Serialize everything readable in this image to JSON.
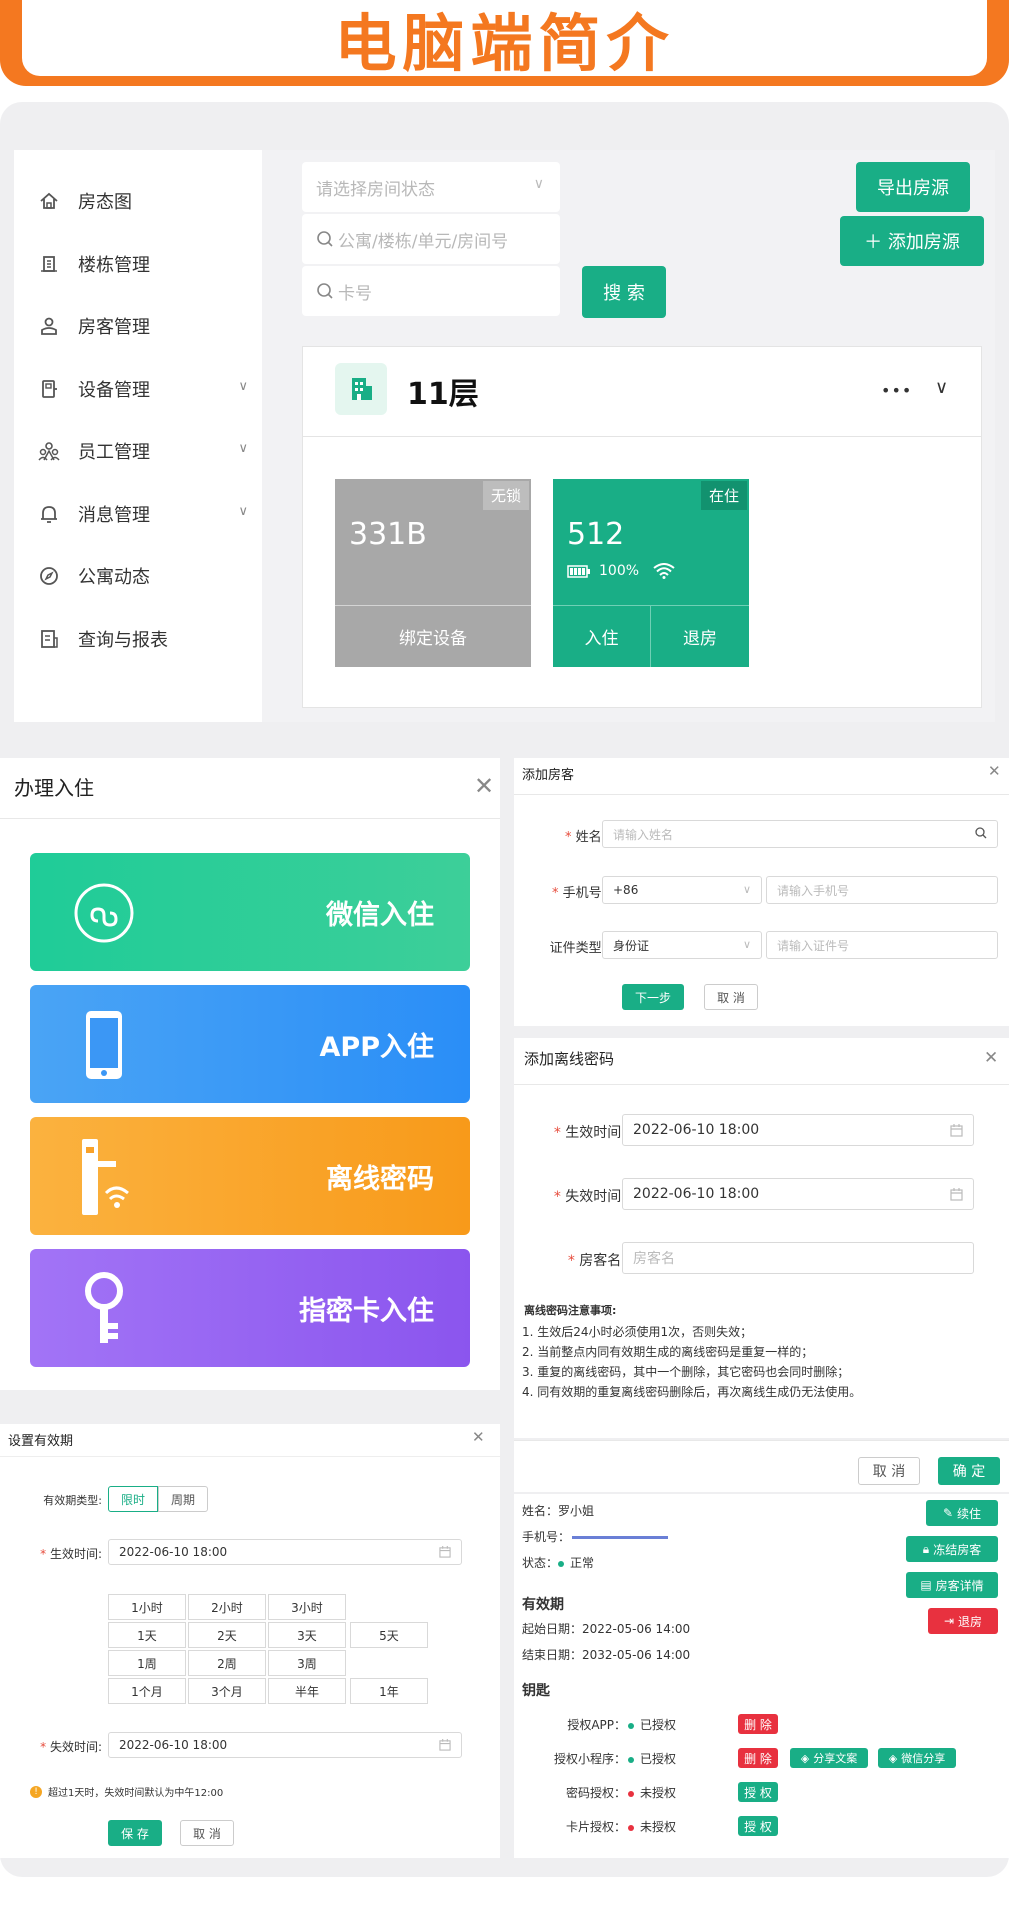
{
  "banner": {
    "title": "电脑端简介"
  },
  "sidebar": {
    "items": [
      {
        "label": "房态图",
        "icon": "home-icon"
      },
      {
        "label": "楼栋管理",
        "icon": "building-icon"
      },
      {
        "label": "房客管理",
        "icon": "user-icon"
      },
      {
        "label": "设备管理",
        "icon": "device-icon",
        "chevron": "∨"
      },
      {
        "label": "员工管理",
        "icon": "staff-icon",
        "chevron": "∨"
      },
      {
        "label": "消息管理",
        "icon": "bell-icon",
        "chevron": "∨"
      },
      {
        "label": "公寓动态",
        "icon": "compass-icon"
      },
      {
        "label": "查询与报表",
        "icon": "report-icon"
      }
    ]
  },
  "filters": {
    "status_placeholder": "请选择房间状态",
    "address_placeholder": "公寓/楼栋/单元/房间号",
    "card_placeholder": "卡号",
    "search_label": "搜 索",
    "export_label": "导出房源",
    "add_label": "＋ 添加房源"
  },
  "floor": {
    "title": "11层",
    "more": "•••",
    "rooms": [
      {
        "number": "331B",
        "badge": "无锁",
        "action": "绑定设备",
        "color": "#a8a8a8"
      },
      {
        "number": "512",
        "badge": "在住",
        "battery": "100%",
        "actions": [
          "入住",
          "退房"
        ],
        "color": "#19ae86"
      }
    ]
  },
  "checkin": {
    "title": "办理入住",
    "options": [
      {
        "label": "微信入住",
        "icon": "mini-program-icon"
      },
      {
        "label": "APP入住",
        "icon": "phone-icon"
      },
      {
        "label": "离线密码",
        "icon": "door-lock-icon"
      },
      {
        "label": "指密卡入住",
        "icon": "key-icon"
      }
    ]
  },
  "add_guest": {
    "title": "添加房客",
    "name_label": "姓名:",
    "name_placeholder": "请输入姓名",
    "phone_label": "手机号:",
    "phone_code": "+86",
    "phone_placeholder": "请输入手机号",
    "id_label": "证件类型:",
    "id_type": "身份证",
    "id_placeholder": "请输入证件号",
    "next_label": "下一步",
    "cancel_label": "取 消"
  },
  "offline_pw": {
    "title": "添加离线密码",
    "start_label": "生效时间:",
    "start_value": "2022-06-10 18:00",
    "end_label": "失效时间:",
    "end_value": "2022-06-10 18:00",
    "guest_label": "房客名:",
    "guest_placeholder": "房客名",
    "notes_title": "离线密码注意事项:",
    "notes": [
      "1. 生效后24小时必须使用1次，否则失效；",
      "2. 当前整点内同有效期生成的离线密码是重复一样的；",
      "3. 重复的离线密码，其中一个删除，其它密码也会同时删除；",
      "4. 同有效期的重复离线密码删除后，再次离线生成仍无法使用。"
    ],
    "cancel_label": "取 消",
    "ok_label": "确 定"
  },
  "validity": {
    "title": "设置有效期",
    "type_label": "有效期类型:",
    "type_options": [
      "限时",
      "周期"
    ],
    "start_label": "生效时间:",
    "start_value": "2022-06-10 18:00",
    "presets": [
      [
        "1小时",
        "2小时",
        "3小时",
        ""
      ],
      [
        "1天",
        "2天",
        "3天",
        "5天"
      ],
      [
        "1周",
        "2周",
        "3周",
        ""
      ],
      [
        "1个月",
        "3个月",
        "半年",
        "1年"
      ]
    ],
    "end_label": "失效时间:",
    "end_value": "2022-06-10 18:00",
    "hint": "超过1天时，失效时间默认为中午12:00",
    "save_label": "保 存",
    "cancel_label": "取 消"
  },
  "guest_detail": {
    "name": "姓名：罗小姐",
    "phone_label": "手机号：",
    "status_label": "状态：",
    "status_value": "正常",
    "validity_title": "有效期",
    "start_date": "起始日期：2022-05-06 14:00",
    "end_date": "结束日期：2032-05-06 14:00",
    "keys_title": "钥匙",
    "actions": [
      "续住",
      "冻结房客",
      "房客详情",
      "退房"
    ],
    "keys": [
      {
        "label": "授权APP：",
        "status": "已授权",
        "ok": true,
        "buttons": [
          "删 除"
        ]
      },
      {
        "label": "授权小程序：",
        "status": "已授权",
        "ok": true,
        "buttons": [
          "删 除",
          "分享文案",
          "微信分享"
        ]
      },
      {
        "label": "密码授权：",
        "status": "未授权",
        "ok": false,
        "buttons": [
          "授 权"
        ]
      },
      {
        "label": "卡片授权：",
        "status": "未授权",
        "ok": false,
        "buttons": [
          "授 权"
        ]
      }
    ]
  },
  "colors": {
    "brand": "#19ae86",
    "banner": "#f47820",
    "danger": "#e8313f"
  }
}
